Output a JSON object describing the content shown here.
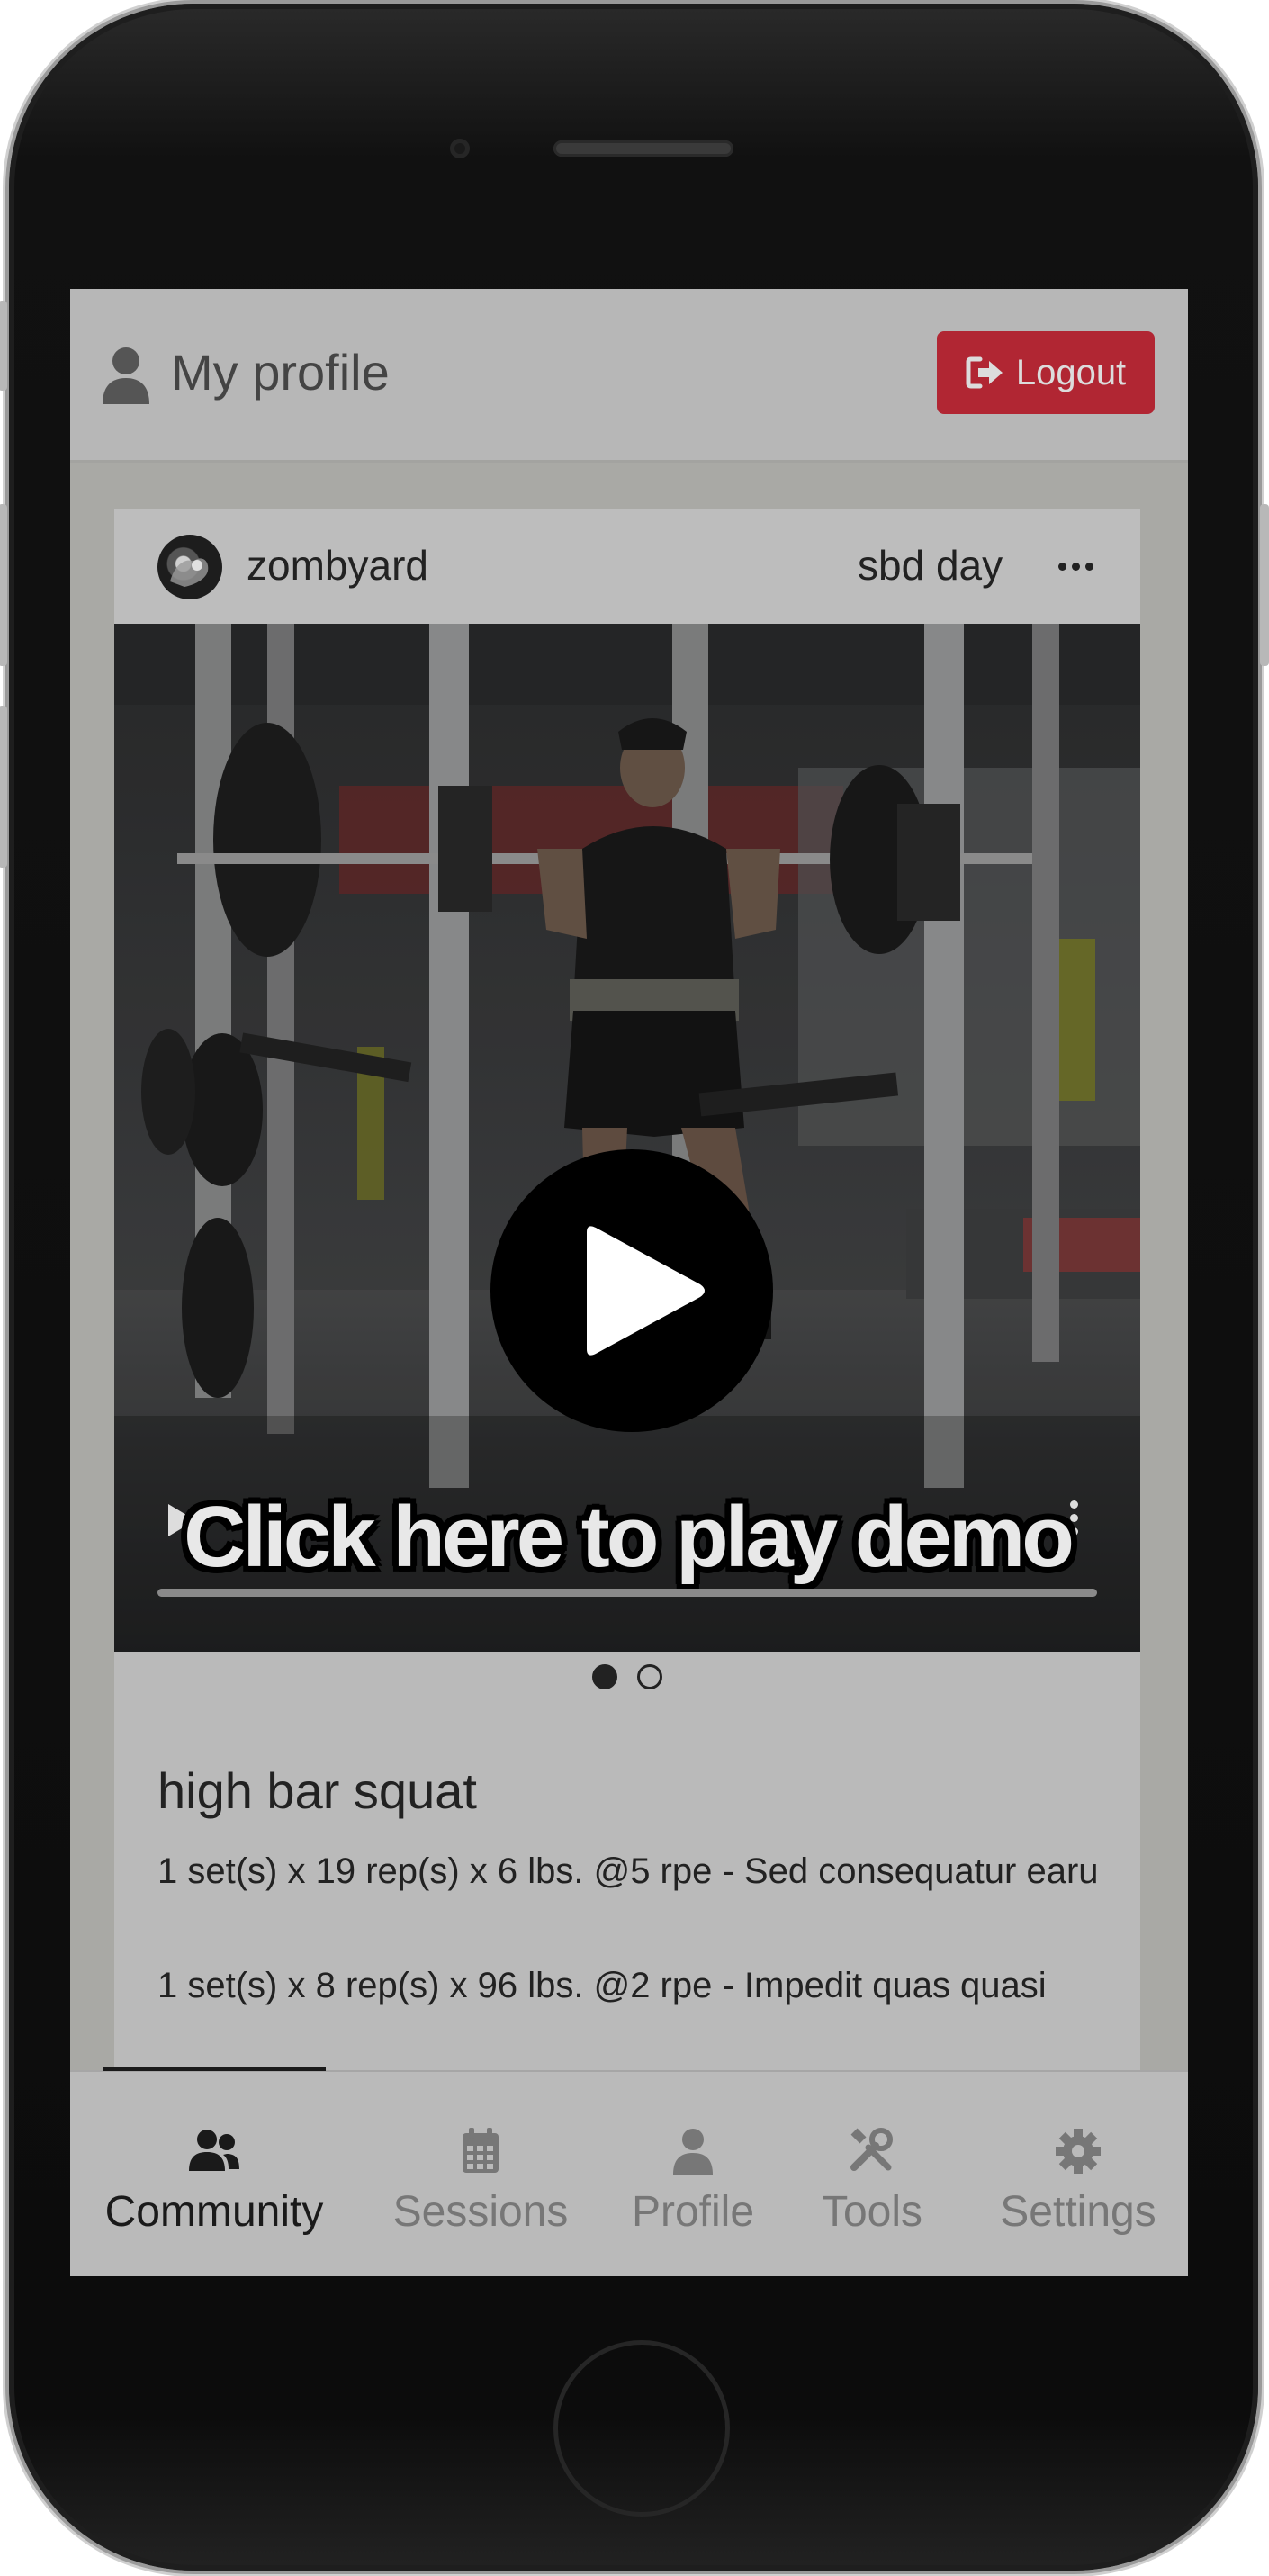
{
  "header": {
    "title": "My profile",
    "logout_label": "Logout",
    "logout_color": "#b12633"
  },
  "post": {
    "username": "zombyard",
    "session_name": "sbd day",
    "more_icon": "ellipsis-icon",
    "media": {
      "overlay_text": "Click here to play demo",
      "slide_count": 2,
      "active_slide": 1
    },
    "exercise": {
      "name": "high bar squat",
      "sets": [
        "1 set(s) x 19 rep(s) x 6 lbs. @5 rpe - Sed consequatur earu",
        "1 set(s) x 8 rep(s) x 96 lbs. @2 rpe - Impedit quas quasi"
      ]
    }
  },
  "nav": {
    "items": [
      {
        "label": "Community",
        "icon": "users-icon",
        "active": true
      },
      {
        "label": "Sessions",
        "icon": "calendar-icon",
        "active": false
      },
      {
        "label": "Profile",
        "icon": "user-icon",
        "active": false
      },
      {
        "label": "Tools",
        "icon": "tools-icon",
        "active": false
      },
      {
        "label": "Settings",
        "icon": "gear-icon",
        "active": false
      }
    ]
  }
}
